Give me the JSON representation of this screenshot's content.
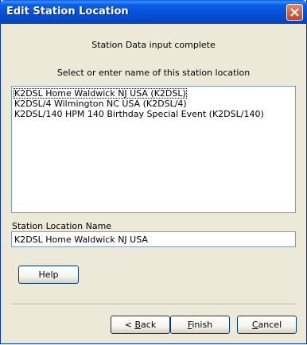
{
  "window": {
    "title": "Edit Station Location",
    "close_icon": "close-icon"
  },
  "main": {
    "status_text": "Station Data input complete",
    "instruction_text": "Select or enter name of this station location",
    "locations": [
      "K2DSL Home Waldwick NJ USA (K2DSL)",
      "K2DSL/4 Wilmington NC USA (K2DSL/4)",
      "K2DSL/140 HPM 140 Birthday Special Event (K2DSL/140)"
    ],
    "selected_index": 0,
    "name_label": "Station Location Name",
    "name_value": "K2DSL Home Waldwick NJ USA"
  },
  "buttons": {
    "help": "Help",
    "back_prefix": "< ",
    "back_accel": "B",
    "back_rest": "ack",
    "finish_accel": "F",
    "finish_rest": "inish",
    "cancel_accel": "C",
    "cancel_rest": "ancel"
  },
  "colors": {
    "titlebar": "#0550d6",
    "face": "#ece9d8",
    "close_button": "#c9401c"
  }
}
